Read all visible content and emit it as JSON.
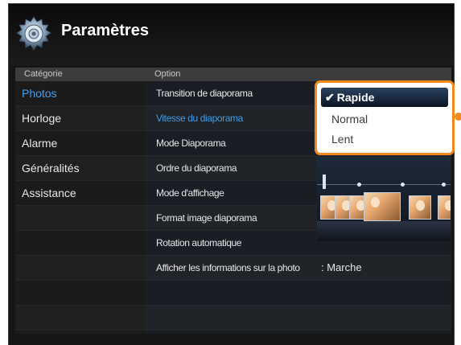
{
  "header": {
    "title": "Paramètres",
    "icon": "gear-icon"
  },
  "columns": {
    "category_label": "Catégorie",
    "option_label": "Option"
  },
  "categories": [
    {
      "label": "Photos",
      "active": true
    },
    {
      "label": "Horloge",
      "active": false
    },
    {
      "label": "Alarme",
      "active": false
    },
    {
      "label": "Généralités",
      "active": false
    },
    {
      "label": "Assistance",
      "active": false
    }
  ],
  "options": [
    {
      "label": "Transition de diaporama",
      "value": ""
    },
    {
      "label": "Vitesse du diaporama",
      "value": "",
      "active": true
    },
    {
      "label": "Mode Diaporama",
      "value": ""
    },
    {
      "label": "Ordre du diaporama",
      "value": ""
    },
    {
      "label": "Mode d'affichage",
      "value": ""
    },
    {
      "label": "Format image diaporama",
      "value": ""
    },
    {
      "label": "Rotation automatique",
      "value": ""
    },
    {
      "label": "Afficher les informations sur la photo",
      "value": ": Marche"
    }
  ],
  "dropdown": {
    "check": "✔",
    "items": [
      {
        "label": "Rapide",
        "selected": true
      },
      {
        "label": "Normal",
        "selected": false
      },
      {
        "label": "Lent",
        "selected": false
      }
    ]
  },
  "colors": {
    "accent": "#3fa0f0",
    "highlight_outline": "#f08a1e",
    "background": "#161616"
  }
}
